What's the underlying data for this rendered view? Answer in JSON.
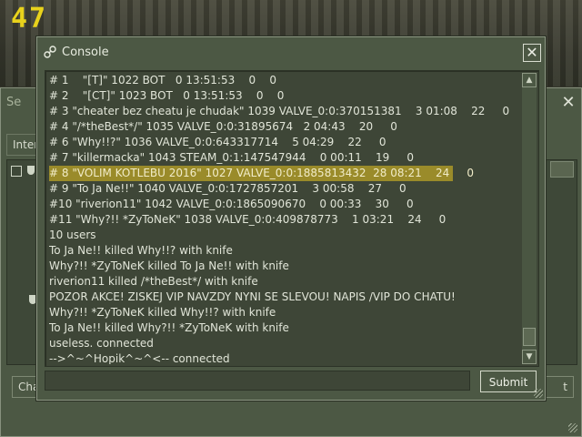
{
  "hud": {
    "fps": "47"
  },
  "background_window": {
    "title": "Se",
    "tab_label": "Inter",
    "left_button": "Cha",
    "right_button": "t"
  },
  "console": {
    "title": "Console",
    "submit_label": "Submit",
    "input_value": "",
    "highlight_color": "#9a8b2a",
    "lines": [
      "# 1    \"[T]\" 1022 BOT   0 13:51:53    0    0",
      "# 2    \"[CT]\" 1023 BOT   0 13:51:53    0    0",
      "# 3 \"cheater bez cheatu je chudak\" 1039 VALVE_0:0:370151381    3 01:08    22     0",
      "# 4 \"/*theBest*/\" 1035 VALVE_0:0:31895674   2 04:43    20     0",
      "# 6 \"Why!!?\" 1036 VALVE_0:0:643317714    5 04:29    22     0",
      "# 7 \"killermacka\" 1043 STEAM_0:1:147547944    0 00:11    19     0",
      "# 8 \"VOLIM KOTLEBU 2016\" 1027 VALVE_0:0:1885813432  28 08:21    24     0",
      "# 9 \"To Ja Ne!!\" 1040 VALVE_0:0:1727857201    3 00:58    27     0",
      "#10 \"riverion11\" 1042 VALVE_0:0:1865090670    0 00:33    30     0",
      "#11 \"Why?!! *ZyToNeK\" 1038 VALVE_0:0:409878773    1 03:21    24     0",
      "10 users",
      "To Ja Ne!! killed Why!!? with knife",
      "Why?!! *ZyToNeK killed To Ja Ne!! with knife",
      "riverion11 killed /*theBest*/ with knife",
      "POZOR AKCE! ZISKEJ VIP NAVZDY NYNI SE SLEVOU! NAPIS /VIP DO CHATU!",
      "Why?!! *ZyToNeK killed Why!!? with knife",
      "To Ja Ne!! killed Why?!! *ZyToNeK with knife",
      "useless. connected",
      "-->^~^Hopik^~^<-- connected"
    ],
    "highlighted_index": 6
  }
}
